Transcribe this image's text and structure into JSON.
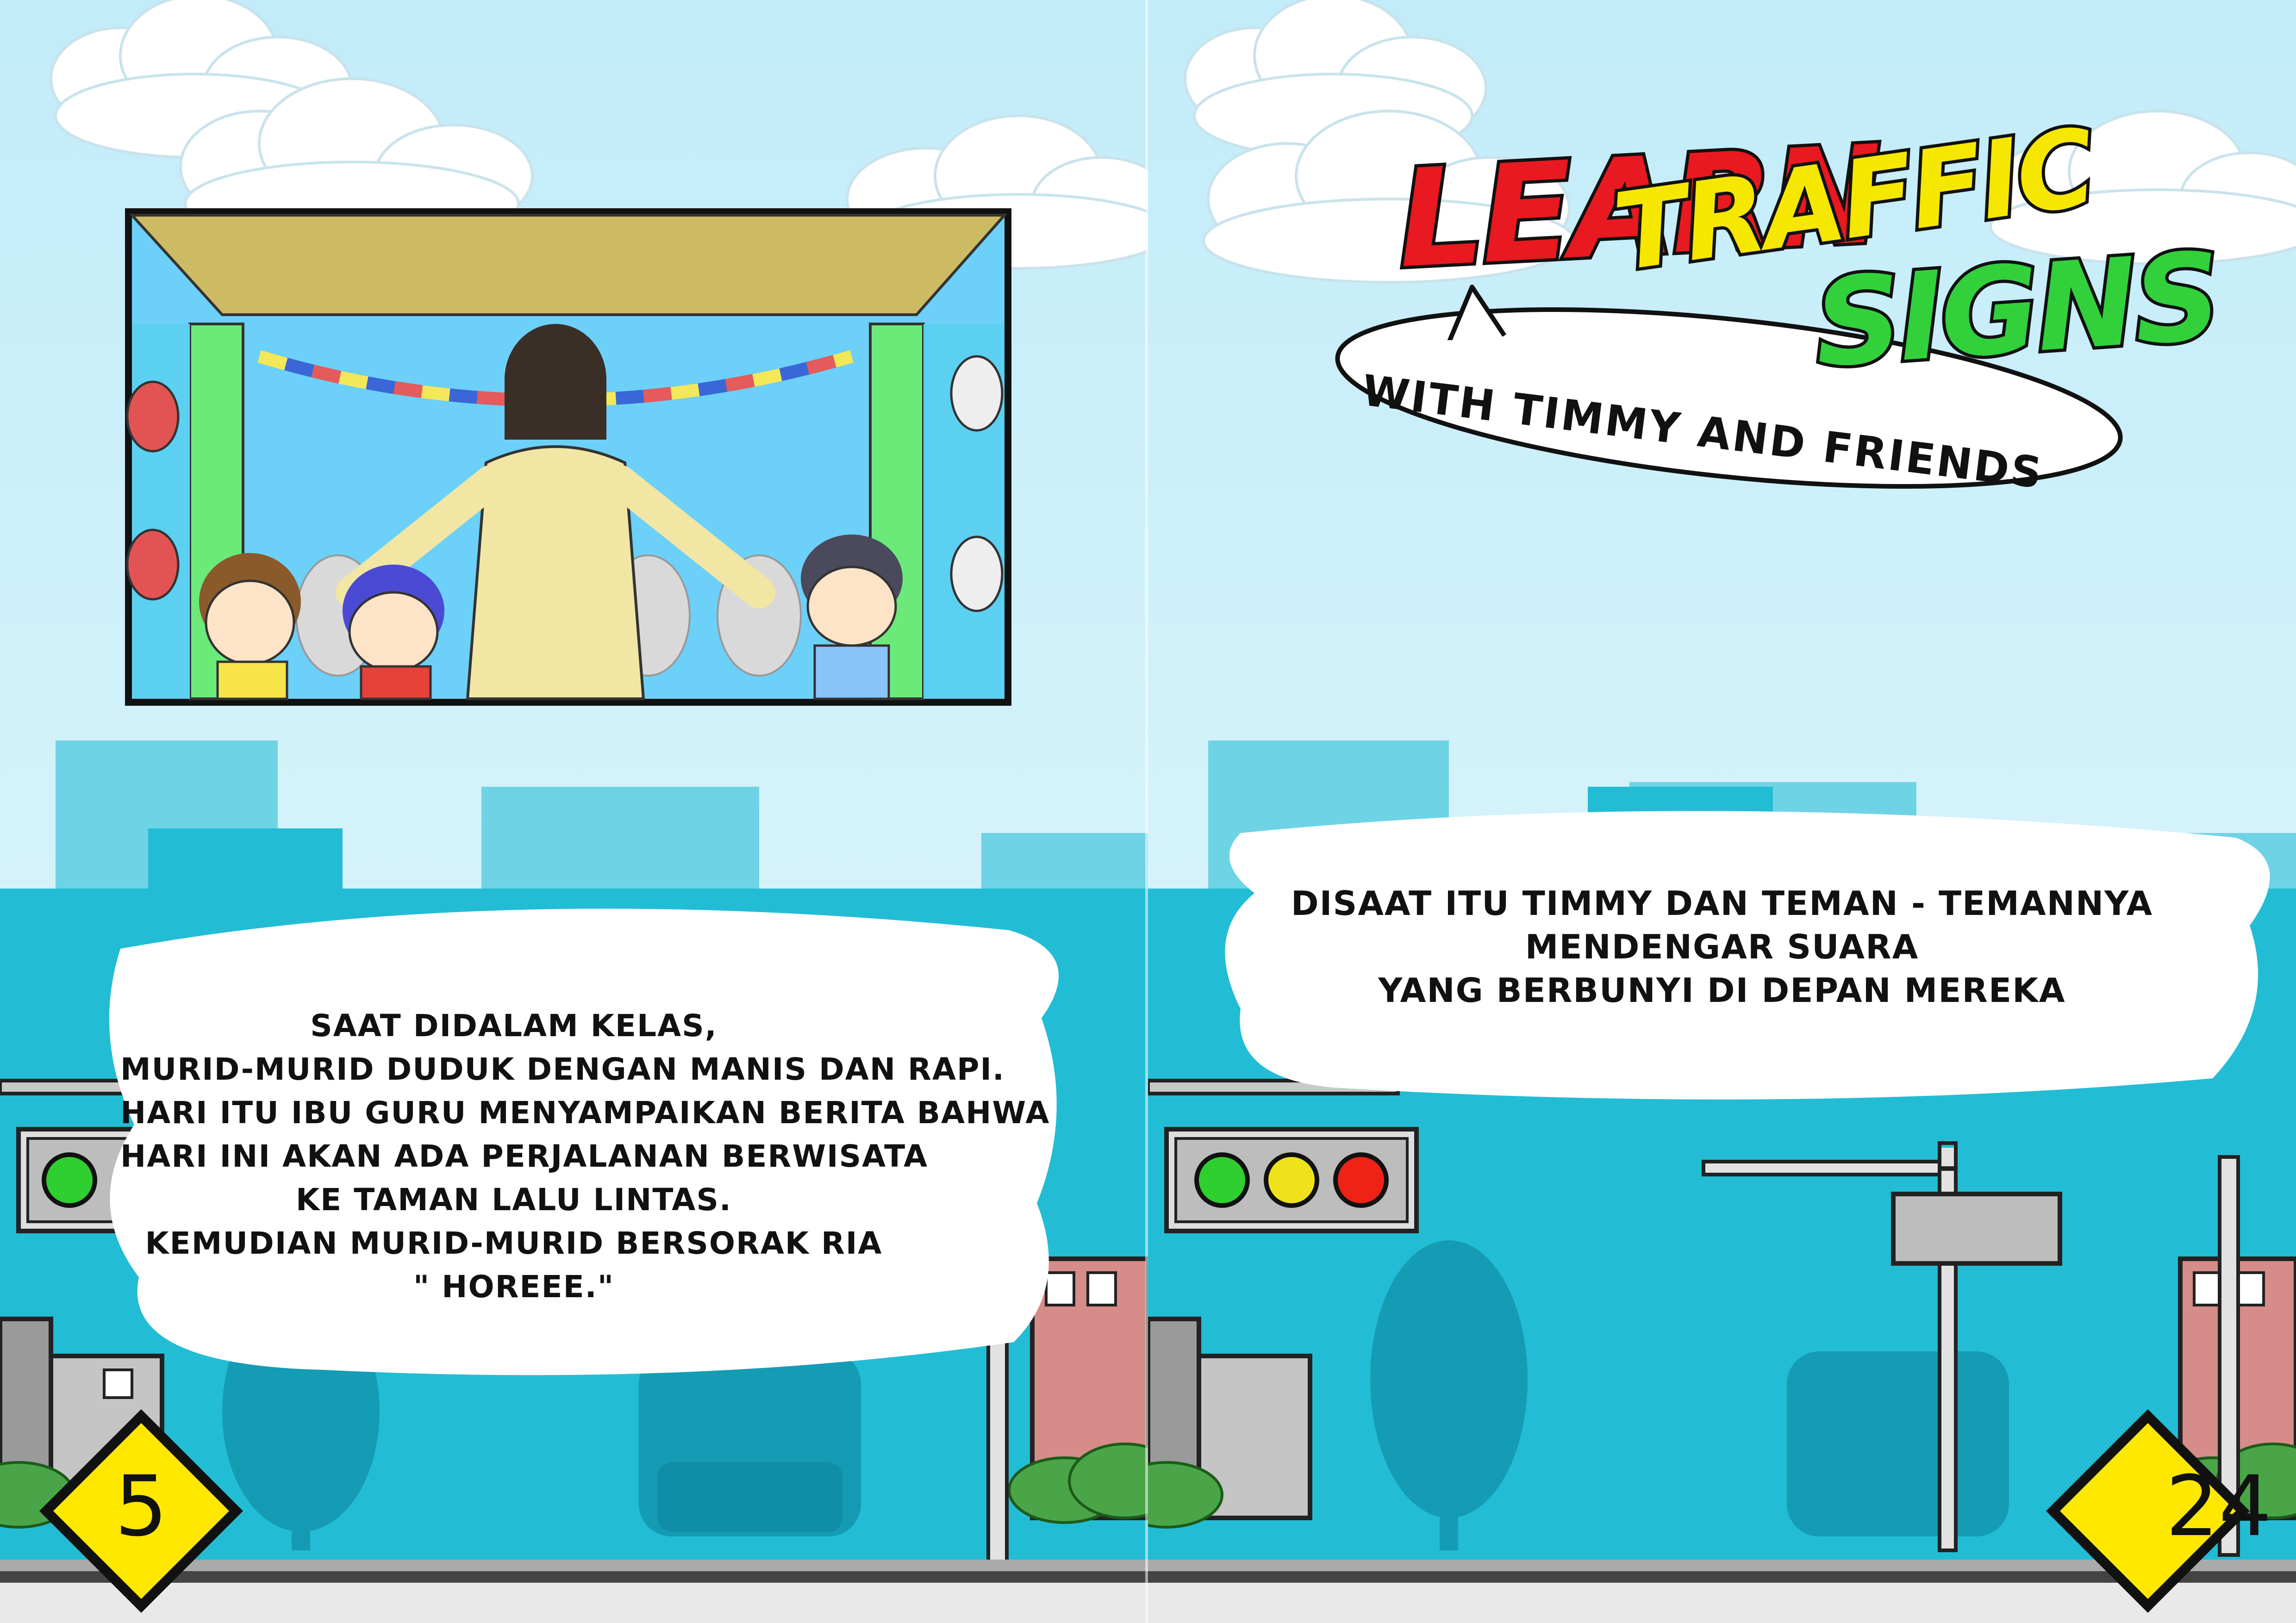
{
  "left_page": {
    "story_lines": [
      "SAAT DIDALAM KELAS,",
      "MURID-MURID DUDUK DENGAN MANIS DAN RAPI.",
      "HARI ITU IBU GURU MENYAMPAIKAN BERITA BAHWA",
      "HARI INI AKAN ADA PERJALANAN BERWISATA",
      "KE TAMAN LALU LINTAS.",
      "KEMUDIAN MURID-MURID BERSORAK RIA",
      "\" HOREEE.\""
    ],
    "page_number": "5"
  },
  "right_page": {
    "logo": {
      "learn": "LEARN",
      "traffic": "TRAFFIC",
      "signs": "SIGNS",
      "subtitle": "WITH TIMMY AND FRIENDS"
    },
    "story_lines": [
      "DISAAT ITU TIMMY DAN TEMAN - TEMANNYA",
      "MENDENGAR SUARA",
      "YANG BERBUNYI DI DEPAN MEREKA"
    ],
    "page_number": "24"
  },
  "colors": {
    "sky": "#c8eef9",
    "building_dark": "#22bdd4",
    "building_light": "#6fd3e6",
    "light_green": "#2fcf2f",
    "light_yellow": "#f0e21a",
    "light_red": "#ef2216",
    "sign_yellow": "#ffe800",
    "logo_red": "#e81920",
    "logo_yellow": "#f6e700",
    "logo_green": "#32d13c"
  },
  "traffic_lights_left": [
    "green",
    "yellow"
  ],
  "traffic_lights_right": [
    "green",
    "yellow",
    "red"
  ],
  "icons": [
    "traffic-light-icon",
    "street-sign-icon",
    "road-sign-icon",
    "cloud-icon"
  ]
}
